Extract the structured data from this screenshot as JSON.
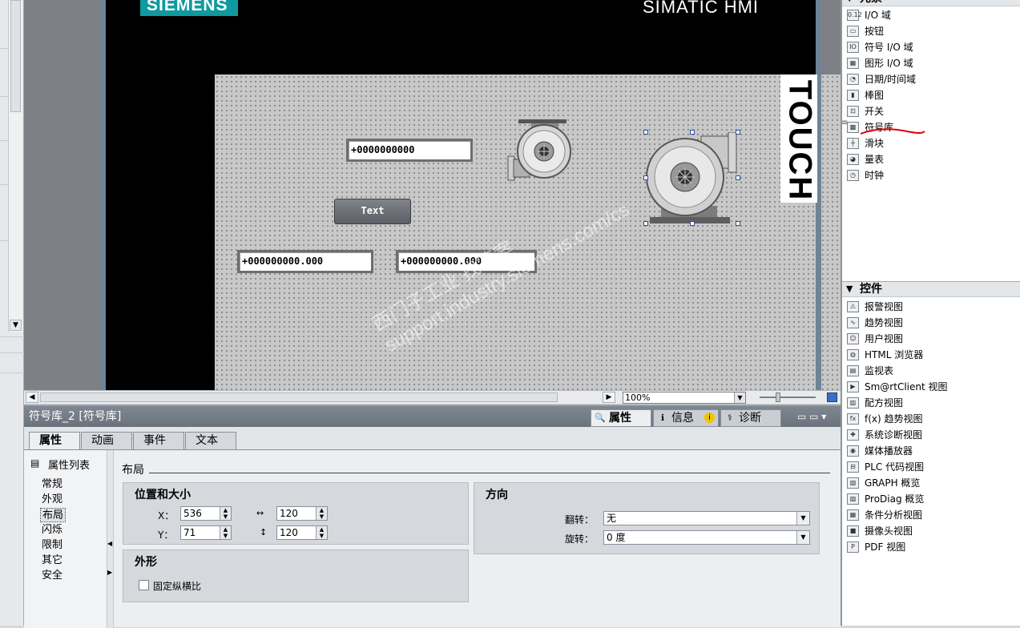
{
  "hmi": {
    "logo": "SIEMENS",
    "product": "SIMATIC HMI",
    "side_label": "TOUCH",
    "io_field_1": "+0000000000",
    "io_field_2": "+000000000.000",
    "io_field_3": "+000000000.000",
    "button_text": "Text"
  },
  "watermark": {
    "line1": "西门子工业  找答案",
    "line2": "support.industry.siemens.com/cs"
  },
  "editor": {
    "zoom": "100%"
  },
  "inspector": {
    "title": "符号库_2 [符号库]",
    "tabs": [
      {
        "label": "属性",
        "icon": "properties-icon"
      },
      {
        "label": "信息",
        "icon": "info-icon"
      },
      {
        "label": "诊断",
        "icon": "diagnostics-icon"
      }
    ],
    "sub_tabs": [
      "属性",
      "动画",
      "事件",
      "文本"
    ],
    "nav_header": "属性列表",
    "nav_items": [
      "常规",
      "外观",
      "布局",
      "闪烁",
      "限制",
      "其它",
      "安全"
    ],
    "section_title": "布局",
    "position_group": {
      "title": "位置和大小",
      "x_label": "X：",
      "x_value": "536",
      "y_label": "Y：",
      "y_value": "71",
      "width_value": "120",
      "height_value": "120"
    },
    "appearance_group": {
      "title": "外形",
      "checkbox_label": "固定纵横比"
    },
    "orientation_group": {
      "title": "方向",
      "flip_label": "翻转：",
      "flip_value": "无",
      "rotate_label": "旋转：",
      "rotate_value": "0 度"
    }
  },
  "toolbox": {
    "elements_header": "元素",
    "elements": [
      {
        "label": "I/O 域",
        "icon": "io-field-icon"
      },
      {
        "label": "按钮",
        "icon": "button-icon"
      },
      {
        "label": "符号 I/O 域",
        "icon": "symbolic-io-field-icon"
      },
      {
        "label": "图形 I/O 域",
        "icon": "graphic-io-field-icon"
      },
      {
        "label": "日期/时间域",
        "icon": "date-time-field-icon"
      },
      {
        "label": "棒图",
        "icon": "bar-graph-icon"
      },
      {
        "label": "开关",
        "icon": "switch-icon"
      },
      {
        "label": "符号库",
        "icon": "symbol-library-icon"
      },
      {
        "label": "滑块",
        "icon": "slider-icon"
      },
      {
        "label": "量表",
        "icon": "gauge-icon"
      },
      {
        "label": "时钟",
        "icon": "clock-icon"
      }
    ],
    "controls_header": "控件",
    "controls": [
      {
        "label": "报警视图",
        "icon": "alarm-view-icon"
      },
      {
        "label": "趋势视图",
        "icon": "trend-view-icon"
      },
      {
        "label": "用户视图",
        "icon": "user-view-icon"
      },
      {
        "label": "HTML 浏览器",
        "icon": "html-browser-icon"
      },
      {
        "label": "监视表",
        "icon": "watch-table-icon"
      },
      {
        "label": "Sm@rtClient 视图",
        "icon": "smartclient-view-icon"
      },
      {
        "label": "配方视图",
        "icon": "recipe-view-icon"
      },
      {
        "label": "f(x) 趋势视图",
        "icon": "fx-trend-view-icon"
      },
      {
        "label": "系统诊断视图",
        "icon": "system-diagnostics-view-icon"
      },
      {
        "label": "媒体播放器",
        "icon": "media-player-icon"
      },
      {
        "label": "PLC 代码视图",
        "icon": "plc-code-view-icon"
      },
      {
        "label": "GRAPH 概览",
        "icon": "graph-overview-icon"
      },
      {
        "label": "ProDiag 概览",
        "icon": "prodiag-overview-icon"
      },
      {
        "label": "条件分析视图",
        "icon": "criteria-analysis-view-icon"
      },
      {
        "label": "摄像头视图",
        "icon": "camera-view-icon"
      },
      {
        "label": "PDF 视图",
        "icon": "pdf-view-icon"
      }
    ]
  }
}
